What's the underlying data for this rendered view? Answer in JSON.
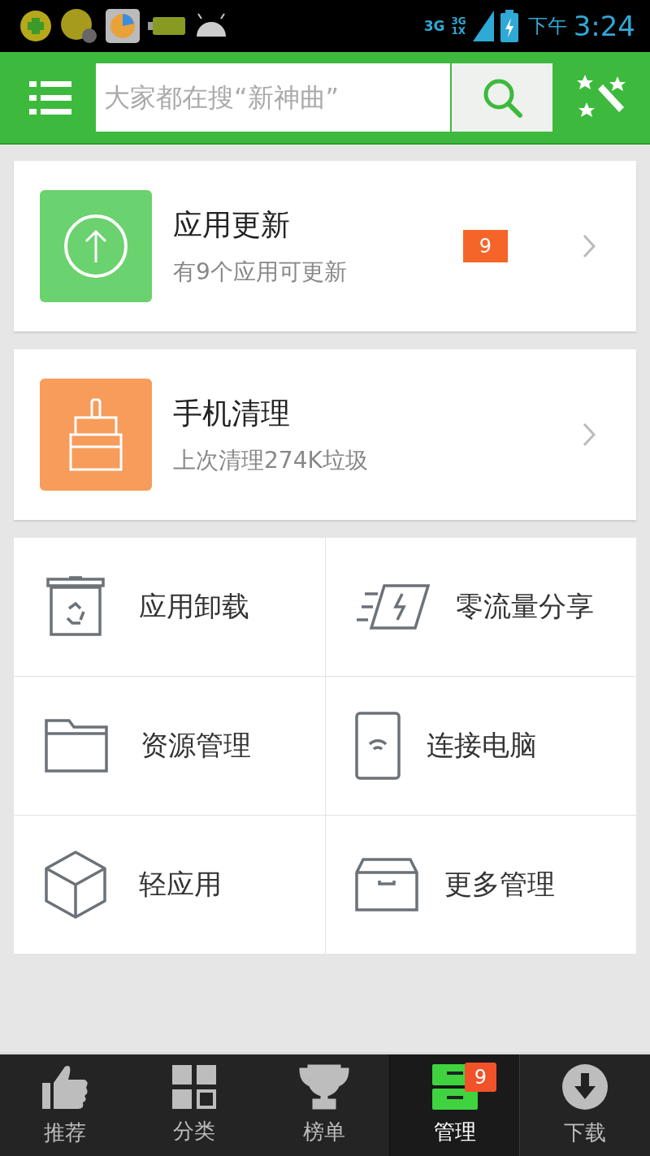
{
  "status_bar": {
    "network": "3G",
    "network2": "3G",
    "network2_sub": "1X",
    "ampm": "下午",
    "time": "3:24"
  },
  "search": {
    "placeholder": "大家都在搜“新神曲”"
  },
  "cards": [
    {
      "kind": "update",
      "title": "应用更新",
      "subtitle": "有9个应用可更新",
      "badge": "9"
    },
    {
      "kind": "clean",
      "title": "手机清理",
      "subtitle": "上次清理274K垃圾"
    }
  ],
  "tools": [
    {
      "kind": "trash",
      "label": "应用卸载"
    },
    {
      "kind": "share",
      "label": "零流量分享"
    },
    {
      "kind": "folder",
      "label": "资源管理"
    },
    {
      "kind": "phone",
      "label": "连接电脑"
    },
    {
      "kind": "cube",
      "label": "轻应用"
    },
    {
      "kind": "box",
      "label": "更多管理"
    }
  ],
  "nav": [
    {
      "kind": "thumb",
      "label": "推荐",
      "selected": false
    },
    {
      "kind": "grid",
      "label": "分类",
      "selected": false
    },
    {
      "kind": "trophy",
      "label": "榜单",
      "selected": false
    },
    {
      "kind": "cabinet",
      "label": "管理",
      "selected": true,
      "badge": "9"
    },
    {
      "kind": "download",
      "label": "下载",
      "selected": false
    }
  ]
}
